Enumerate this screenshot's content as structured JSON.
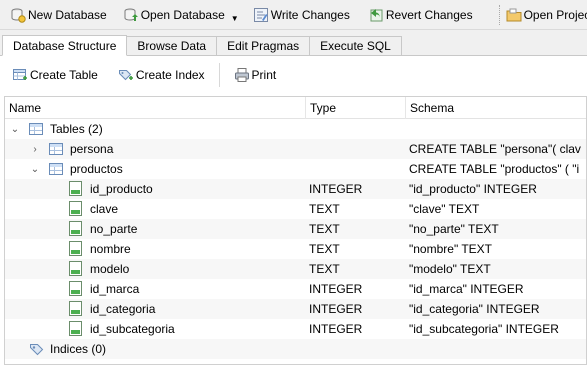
{
  "toolbar": {
    "new_database": "New Database",
    "open_database": "Open Database",
    "write_changes": "Write Changes",
    "revert_changes": "Revert Changes",
    "open_project": "Open Project"
  },
  "tabs": [
    {
      "label": "Database Structure",
      "active": true
    },
    {
      "label": "Browse Data",
      "active": false
    },
    {
      "label": "Edit Pragmas",
      "active": false
    },
    {
      "label": "Execute SQL",
      "active": false
    }
  ],
  "structure_toolbar": {
    "create_table": "Create Table",
    "create_index": "Create Index",
    "print": "Print"
  },
  "tree": {
    "columns": {
      "name": "Name",
      "type": "Type",
      "schema": "Schema"
    },
    "tables_node": "Tables (2)",
    "persona": {
      "name": "persona",
      "schema": "CREATE TABLE \"persona\"( clav"
    },
    "productos": {
      "name": "productos",
      "schema": "CREATE TABLE \"productos\" ( \"i"
    },
    "fields": [
      {
        "name": "id_producto",
        "type": "INTEGER",
        "schema": "\"id_producto\" INTEGER"
      },
      {
        "name": "clave",
        "type": "TEXT",
        "schema": "\"clave\" TEXT"
      },
      {
        "name": "no_parte",
        "type": "TEXT",
        "schema": "\"no_parte\" TEXT"
      },
      {
        "name": "nombre",
        "type": "TEXT",
        "schema": "\"nombre\" TEXT"
      },
      {
        "name": "modelo",
        "type": "TEXT",
        "schema": "\"modelo\" TEXT"
      },
      {
        "name": "id_marca",
        "type": "INTEGER",
        "schema": "\"id_marca\" INTEGER"
      },
      {
        "name": "id_categoria",
        "type": "INTEGER",
        "schema": "\"id_categoria\" INTEGER"
      },
      {
        "name": "id_subcategoria",
        "type": "INTEGER",
        "schema": "\"id_subcategoria\" INTEGER"
      }
    ],
    "indices_node": "Indices (0)"
  },
  "icons": {
    "new_database": "new-database-icon",
    "open_database": "open-database-icon",
    "write_changes": "write-changes-icon",
    "revert_changes": "revert-changes-icon",
    "open_project": "open-project-icon",
    "create_table": "create-table-icon",
    "create_index": "create-index-icon",
    "print": "print-icon"
  }
}
